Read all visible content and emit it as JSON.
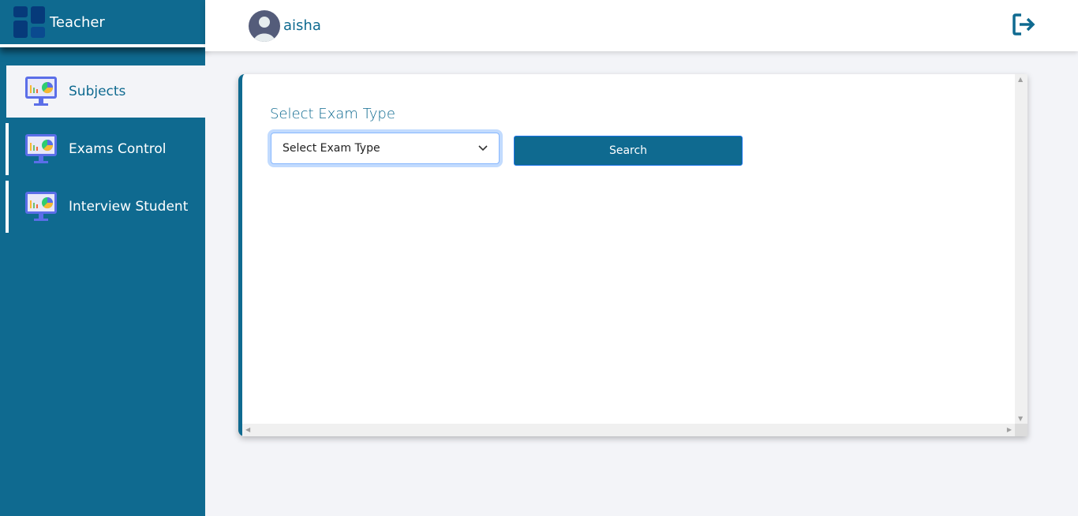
{
  "sidebar": {
    "title": "Teacher",
    "items": [
      {
        "label": "Subjects",
        "active": true
      },
      {
        "label": "Exams Control"
      },
      {
        "label": "Interview Student"
      }
    ]
  },
  "topbar": {
    "username": "aisha"
  },
  "main": {
    "field_label": "Select Exam Type",
    "select_value": "Select Exam Type",
    "search_label": "Search"
  },
  "colors": {
    "primary": "#0f6a90",
    "background": "#f3f4f8"
  }
}
